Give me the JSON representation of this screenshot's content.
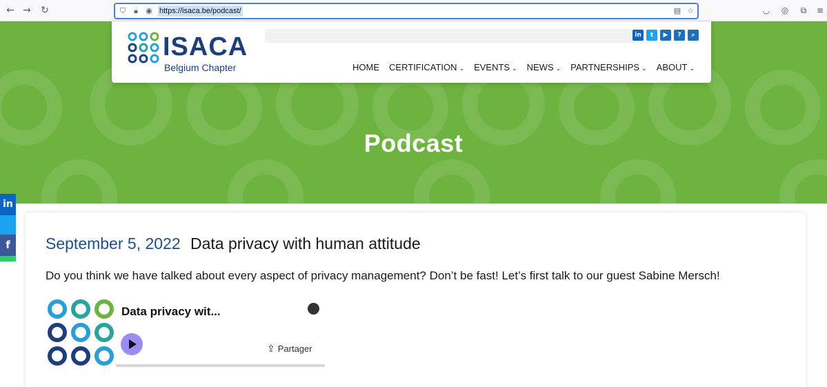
{
  "browser": {
    "url": "https://isaca.be/podcast/",
    "icons": [
      "back-icon",
      "forward-icon",
      "reload-icon",
      "shield-icon",
      "lock-icon",
      "site-icon",
      "reader-icon",
      "bookmark-star-icon",
      "pocket-icon",
      "account-icon",
      "extensions-icon",
      "menu-icon"
    ]
  },
  "header": {
    "logo_text": "ISACA",
    "logo_subtitle": "Belgium Chapter",
    "social_icons": [
      {
        "name": "linkedin-icon",
        "glyph": "in",
        "color": "#0a66c2"
      },
      {
        "name": "twitter-icon",
        "glyph": "t",
        "color": "#1da1f2"
      },
      {
        "name": "youtube-icon",
        "glyph": "▶",
        "color": "#1d6fb8"
      },
      {
        "name": "help-icon",
        "glyph": "?",
        "color": "#1d6fb8"
      },
      {
        "name": "search-icon",
        "glyph": "⌕",
        "color": "#1d6fb8"
      }
    ],
    "menu": [
      {
        "label": "HOME",
        "has_dropdown": false
      },
      {
        "label": "CERTIFICATION",
        "has_dropdown": true
      },
      {
        "label": "EVENTS",
        "has_dropdown": true
      },
      {
        "label": "NEWS",
        "has_dropdown": true
      },
      {
        "label": "PARTNERSHIPS",
        "has_dropdown": true
      },
      {
        "label": "ABOUT",
        "has_dropdown": true
      }
    ]
  },
  "hero": {
    "title": "Podcast",
    "background_color": "#6db33f"
  },
  "share_bar": {
    "linkedin": "in",
    "facebook": "f"
  },
  "post": {
    "date": "September 5, 2022",
    "title": "Data privacy with human attitude",
    "text": "Do you think we have talked about every aspect of privacy management?  Don’t be fast! Let’s first talk to our guest Sabine Mersch!"
  },
  "embed": {
    "title": "Data privacy wit...",
    "share_label": "Partager",
    "progress": 0.0
  },
  "colors": {
    "brand_blue": "#1d3f7a",
    "brand_green": "#6db33f",
    "date_blue": "#1d4f8c"
  }
}
